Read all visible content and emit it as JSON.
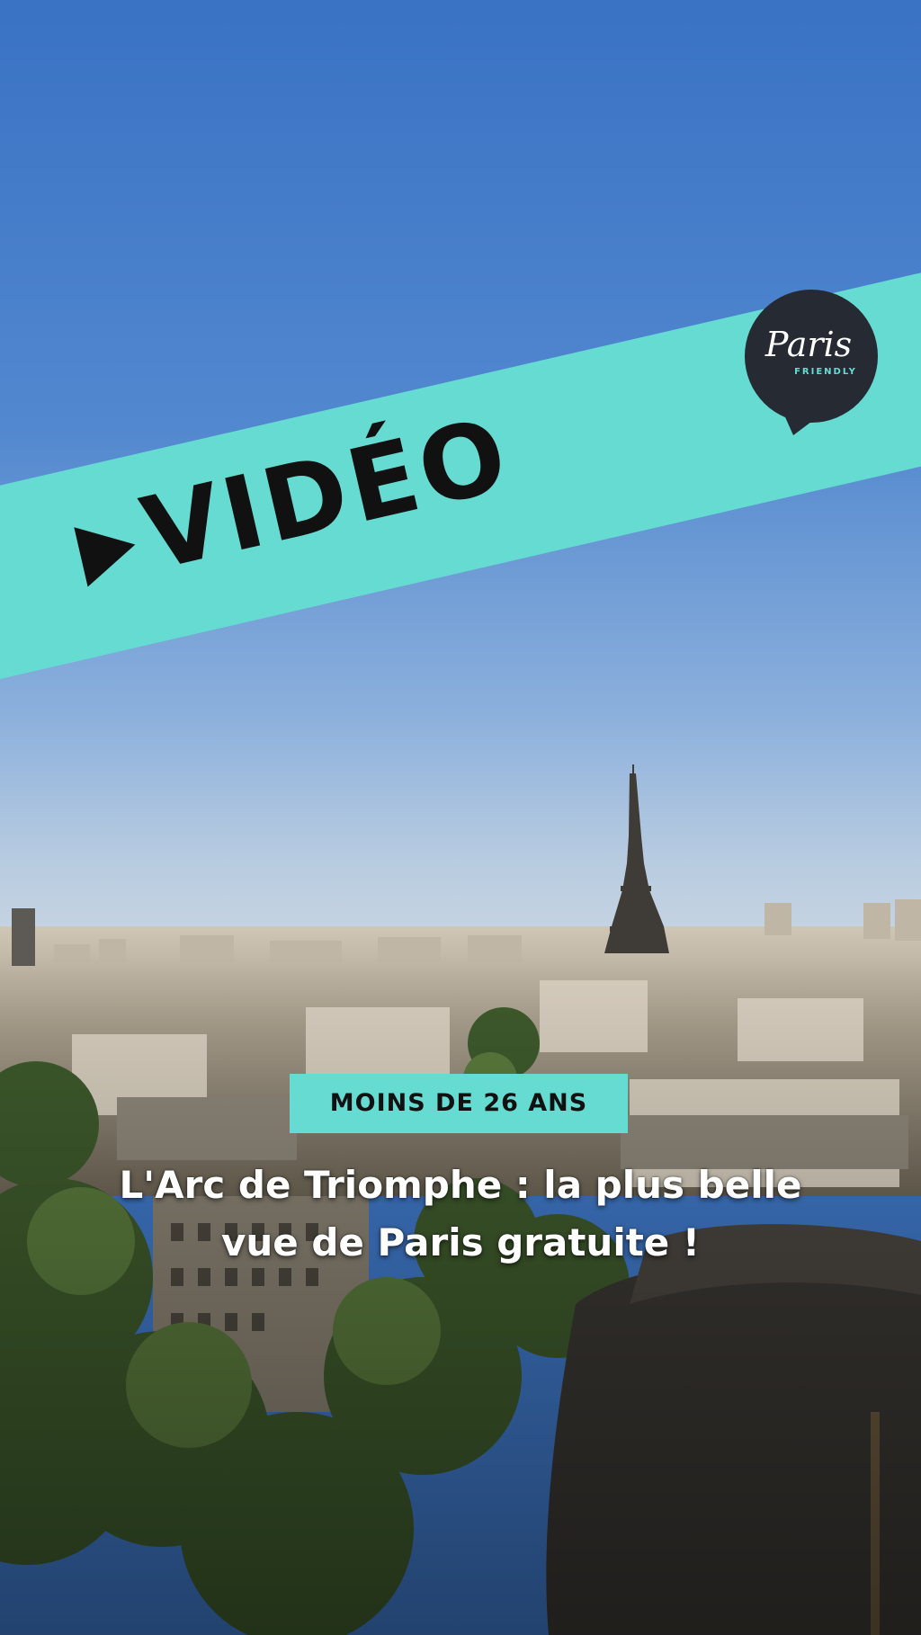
{
  "ribbon": {
    "label": "VIDÉO",
    "play_icon": "play-triangle-icon",
    "color": "#66dbd2"
  },
  "logo": {
    "script": "Paris",
    "sub": "FRIENDLY",
    "bg_color": "#252a33"
  },
  "badge": {
    "label": "MOINS DE 26 ANS"
  },
  "headline": {
    "line1": "L'Arc de Triomphe : la plus belle",
    "line2": "vue de Paris gratuite !"
  },
  "colors": {
    "accent": "#66dbd2",
    "sky_top": "#3f78c8",
    "sky_horizon": "#b9cce0"
  }
}
